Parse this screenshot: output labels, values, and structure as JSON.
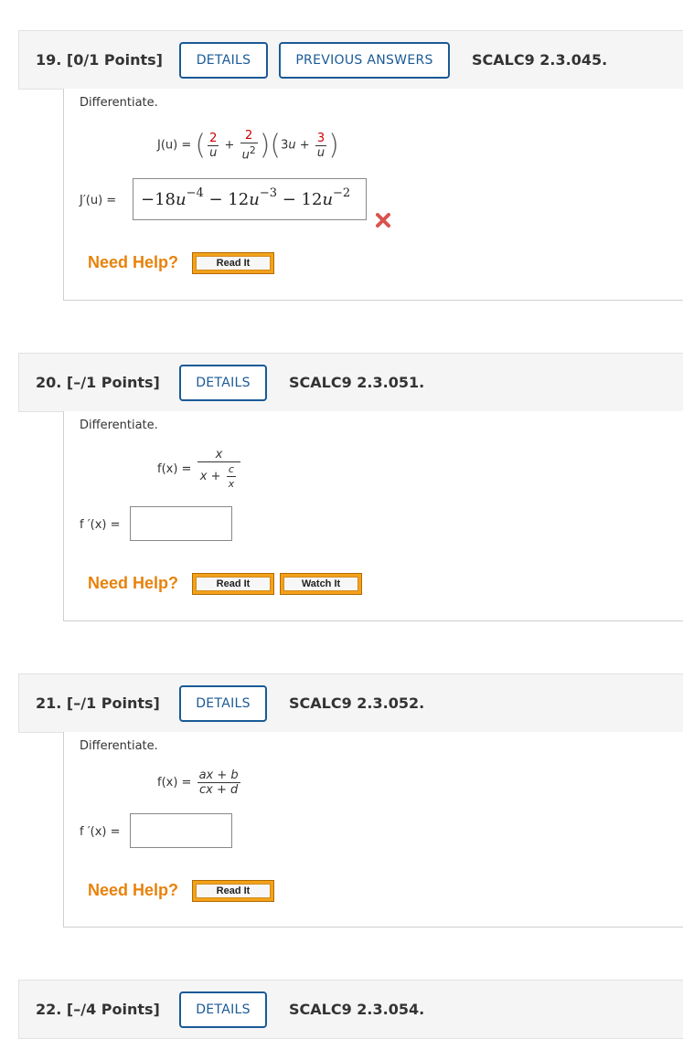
{
  "questions": [
    {
      "number": "19.",
      "points": "[0/1 Points]",
      "details_label": "DETAILS",
      "previous_answers_label": "PREVIOUS ANSWERS",
      "code": "SCALC9 2.3.045.",
      "prompt": "Differentiate.",
      "function_lhs": "J(u) =",
      "derivative_lhs": "J′(u) =",
      "answer": {
        "t1_coef": "−18",
        "t1_var": "u",
        "t1_exp": "−4",
        "t2_coef": "− 12",
        "t2_var": "u",
        "t2_exp": "−3",
        "t3_coef": "− 12",
        "t3_var": "u",
        "t3_exp": "−2"
      },
      "need_help": "Need Help?",
      "help_buttons": [
        "Read It"
      ],
      "status": "incorrect"
    },
    {
      "number": "20.",
      "points": "[–/1 Points]",
      "details_label": "DETAILS",
      "code": "SCALC9 2.3.051.",
      "prompt": "Differentiate.",
      "function_lhs": "f(x) =",
      "derivative_lhs": "f ′(x) =",
      "need_help": "Need Help?",
      "help_buttons": [
        "Read It",
        "Watch It"
      ]
    },
    {
      "number": "21.",
      "points": "[–/1 Points]",
      "details_label": "DETAILS",
      "code": "SCALC9 2.3.052.",
      "prompt": "Differentiate.",
      "function_lhs": "f(x) =",
      "function_num": "ax + b",
      "function_den": "cx + d",
      "derivative_lhs": "f ′(x) =",
      "need_help": "Need Help?",
      "help_buttons": [
        "Read It"
      ]
    },
    {
      "number": "22.",
      "points": "[–/4 Points]",
      "details_label": "DETAILS",
      "code": "SCALC9 2.3.054."
    }
  ],
  "colors": {
    "link_blue": "#1a5a96",
    "need_help_orange": "#e8820c",
    "incorrect_red": "#d9534f",
    "header_bg": "#f5f5f5"
  },
  "icons": {
    "incorrect": "x-mark-icon"
  }
}
